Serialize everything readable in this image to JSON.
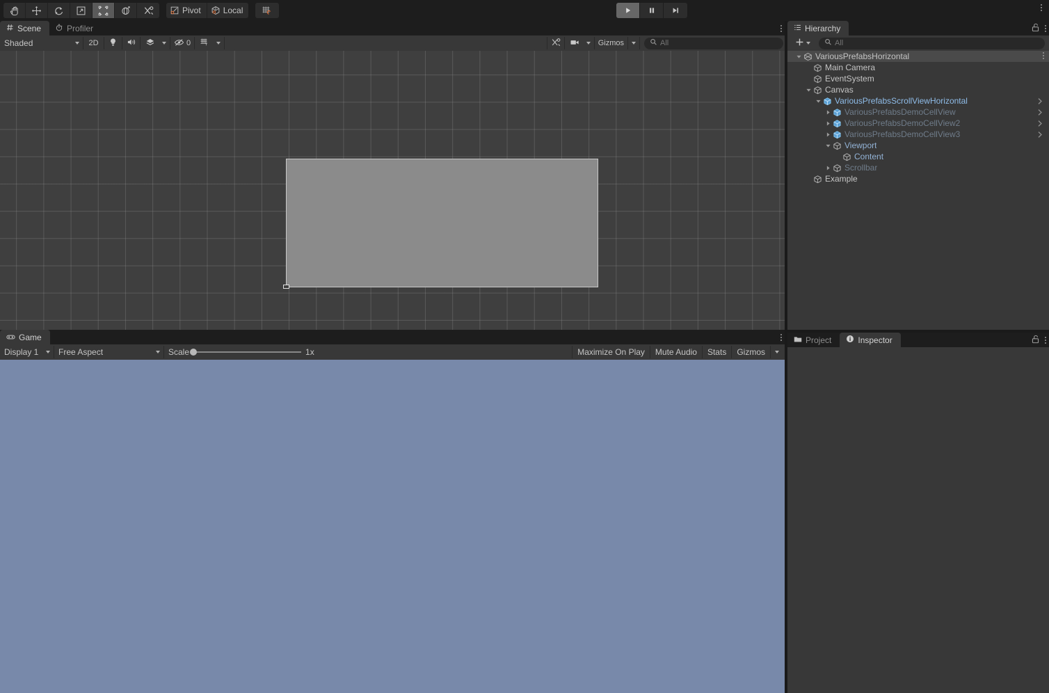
{
  "toolbar": {
    "tools": [
      {
        "name": "hand-tool",
        "icon": "hand",
        "active": false
      },
      {
        "name": "move-tool",
        "icon": "move",
        "active": false
      },
      {
        "name": "rotate-tool",
        "icon": "rotate",
        "active": false
      },
      {
        "name": "scale-tool",
        "icon": "scale",
        "active": false
      },
      {
        "name": "rect-tool",
        "icon": "rect",
        "active": true
      },
      {
        "name": "transform-tool",
        "icon": "transform",
        "active": false
      },
      {
        "name": "custom-tool",
        "icon": "wrench",
        "active": false
      }
    ],
    "pivot_label": "Pivot",
    "local_label": "Local",
    "snap_label": "grid-snapping",
    "play_label": "play",
    "pause_label": "pause",
    "step_label": "step"
  },
  "scene": {
    "tabs": [
      {
        "label": "Scene",
        "icon": "hash-icon",
        "active": true
      },
      {
        "label": "Profiler",
        "icon": "stopwatch-icon",
        "active": false
      }
    ],
    "shading_mode": "Shaded",
    "toggle_2d": "2D",
    "hidden_count": "0",
    "gizmos_label": "Gizmos",
    "search_placeholder": "All",
    "search_value": ""
  },
  "game": {
    "tabs": [
      {
        "label": "Game",
        "icon": "gamepad-icon",
        "active": true
      }
    ],
    "display": "Display 1",
    "aspect": "Free Aspect",
    "scale_label": "Scale",
    "scale_value": "1x",
    "maximize_label": "Maximize On Play",
    "mute_label": "Mute Audio",
    "stats_label": "Stats",
    "gizmos_label": "Gizmos",
    "background_color": "#7889aa"
  },
  "hierarchy": {
    "tab_label": "Hierarchy",
    "tab_icon": "list-icon",
    "add_label": "+",
    "search_placeholder": "All",
    "search_value": "",
    "items": [
      {
        "label": "VariousPrefabsHorizontal",
        "depth": 0,
        "twisty": "down",
        "icon": "scene-icon",
        "style": "normal",
        "selected": true,
        "chevron": false,
        "kebab": true
      },
      {
        "label": "Main Camera",
        "depth": 1,
        "twisty": "none",
        "icon": "cube-icon",
        "style": "normal",
        "selected": false,
        "chevron": false,
        "kebab": false
      },
      {
        "label": "EventSystem",
        "depth": 1,
        "twisty": "none",
        "icon": "cube-icon",
        "style": "normal",
        "selected": false,
        "chevron": false,
        "kebab": false
      },
      {
        "label": "Canvas",
        "depth": 1,
        "twisty": "down",
        "icon": "cube-icon",
        "style": "normal",
        "selected": false,
        "chevron": false,
        "kebab": false
      },
      {
        "label": "VariousPrefabsScrollViewHorizontal",
        "depth": 2,
        "twisty": "down",
        "icon": "prefab-icon",
        "style": "prefab",
        "selected": false,
        "chevron": true,
        "kebab": false
      },
      {
        "label": "VariousPrefabsDemoCellView",
        "depth": 3,
        "twisty": "right",
        "icon": "prefab-icon",
        "style": "dim",
        "selected": false,
        "chevron": true,
        "kebab": false
      },
      {
        "label": "VariousPrefabsDemoCellView2",
        "depth": 3,
        "twisty": "right",
        "icon": "prefab-icon",
        "style": "dim",
        "selected": false,
        "chevron": true,
        "kebab": false
      },
      {
        "label": "VariousPrefabsDemoCellView3",
        "depth": 3,
        "twisty": "right",
        "icon": "prefab-icon",
        "style": "dim",
        "selected": false,
        "chevron": true,
        "kebab": false
      },
      {
        "label": "Viewport",
        "depth": 3,
        "twisty": "down",
        "icon": "cube-icon",
        "style": "blue",
        "selected": false,
        "chevron": false,
        "kebab": false
      },
      {
        "label": "Content",
        "depth": 4,
        "twisty": "none",
        "icon": "cube-icon",
        "style": "blue",
        "selected": false,
        "chevron": false,
        "kebab": false
      },
      {
        "label": "Scrollbar",
        "depth": 3,
        "twisty": "right",
        "icon": "cube-icon",
        "style": "dim",
        "selected": false,
        "chevron": false,
        "kebab": false
      },
      {
        "label": "Example",
        "depth": 1,
        "twisty": "none",
        "icon": "cube-icon",
        "style": "normal",
        "selected": false,
        "chevron": false,
        "kebab": false
      }
    ]
  },
  "bottom_right": {
    "tabs": [
      {
        "label": "Project",
        "icon": "folder-icon",
        "active": false
      },
      {
        "label": "Inspector",
        "icon": "info-icon",
        "active": true
      }
    ]
  },
  "colors": {
    "panel_bg": "#383838",
    "chrome_bg": "#1d1d1d",
    "scene_bg": "#3f3f3f",
    "game_bg": "#7889aa",
    "prefab_blue": "#8fbce8",
    "accent_orange": "#cc6633"
  }
}
